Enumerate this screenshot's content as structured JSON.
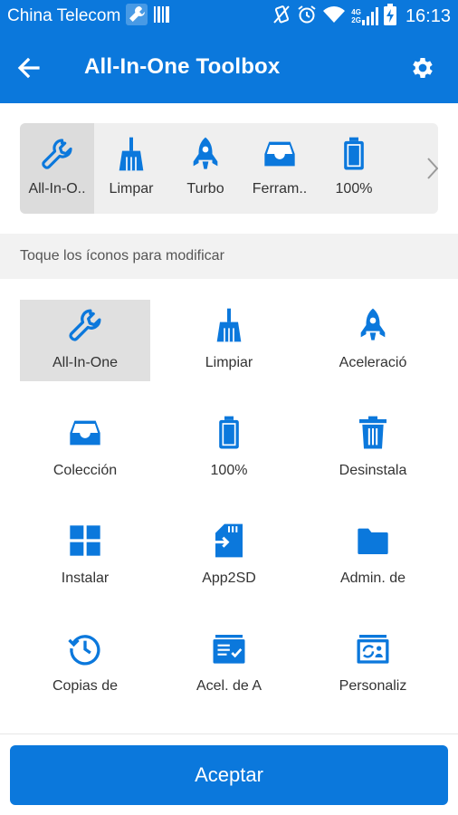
{
  "status_bar": {
    "carrier": "China Telecom",
    "network_label_top": "4G",
    "network_label_bottom": "2G",
    "time": "16:13"
  },
  "app_bar": {
    "title": "All-In-One Toolbox"
  },
  "quick_bar": {
    "items": [
      {
        "label": "All-In-O..",
        "icon": "wrench-icon",
        "selected": true
      },
      {
        "label": "Limpar",
        "icon": "broom-icon"
      },
      {
        "label": "Turbo",
        "icon": "rocket-icon"
      },
      {
        "label": "Ferram..",
        "icon": "tray-icon"
      },
      {
        "label": "100%",
        "icon": "battery-icon"
      }
    ]
  },
  "hint": "Toque los íconos para modificar",
  "grid": {
    "items": [
      {
        "label": "All-In-One",
        "icon": "wrench-icon",
        "selected": true
      },
      {
        "label": "Limpiar",
        "icon": "broom-icon"
      },
      {
        "label": "Aceleració",
        "icon": "rocket-icon"
      },
      {
        "label": "Colección",
        "icon": "tray-icon"
      },
      {
        "label": "100%",
        "icon": "battery-icon"
      },
      {
        "label": "Desinstala",
        "icon": "trash-icon"
      },
      {
        "label": "Instalar",
        "icon": "apps-grid-icon"
      },
      {
        "label": "App2SD",
        "icon": "sd-card-icon"
      },
      {
        "label": "Admin. de",
        "icon": "folder-icon"
      },
      {
        "label": "Copias de",
        "icon": "history-icon"
      },
      {
        "label": "Acel. de A",
        "icon": "checklist-card-icon"
      },
      {
        "label": "Personaliz",
        "icon": "contact-card-icon"
      }
    ]
  },
  "accept_button": "Aceptar",
  "colors": {
    "primary": "#0b78dc",
    "selected_bg": "#dcdcdc",
    "panel_bg": "#efefef"
  }
}
